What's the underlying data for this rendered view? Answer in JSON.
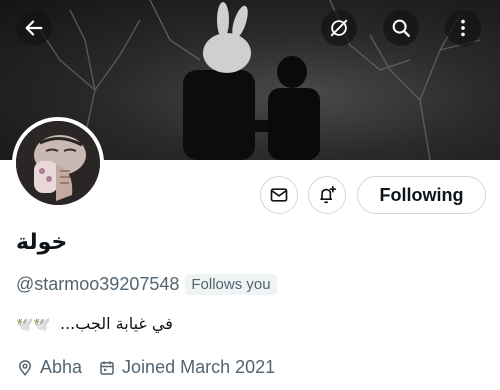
{
  "profile": {
    "display_name": "خولة",
    "handle": "@starmoo39207548",
    "follows_you_label": "Follows you",
    "bio_text": "في غيابة الجب...",
    "bio_emoji": "🕊️🕊️",
    "location": "Abha",
    "joined": "Joined March 2021"
  },
  "actions": {
    "following_label": "Following"
  },
  "icons": {
    "back": "arrow-left-icon",
    "grok": "grok-icon",
    "search": "search-icon",
    "more": "more-vertical-icon",
    "message": "envelope-icon",
    "notify": "bell-plus-icon",
    "location": "location-pin-icon",
    "calendar": "calendar-icon"
  },
  "colors": {
    "text_primary": "#0f1419",
    "text_secondary": "#536471",
    "border": "#cfd9de",
    "badge_bg": "#eff3f4"
  }
}
